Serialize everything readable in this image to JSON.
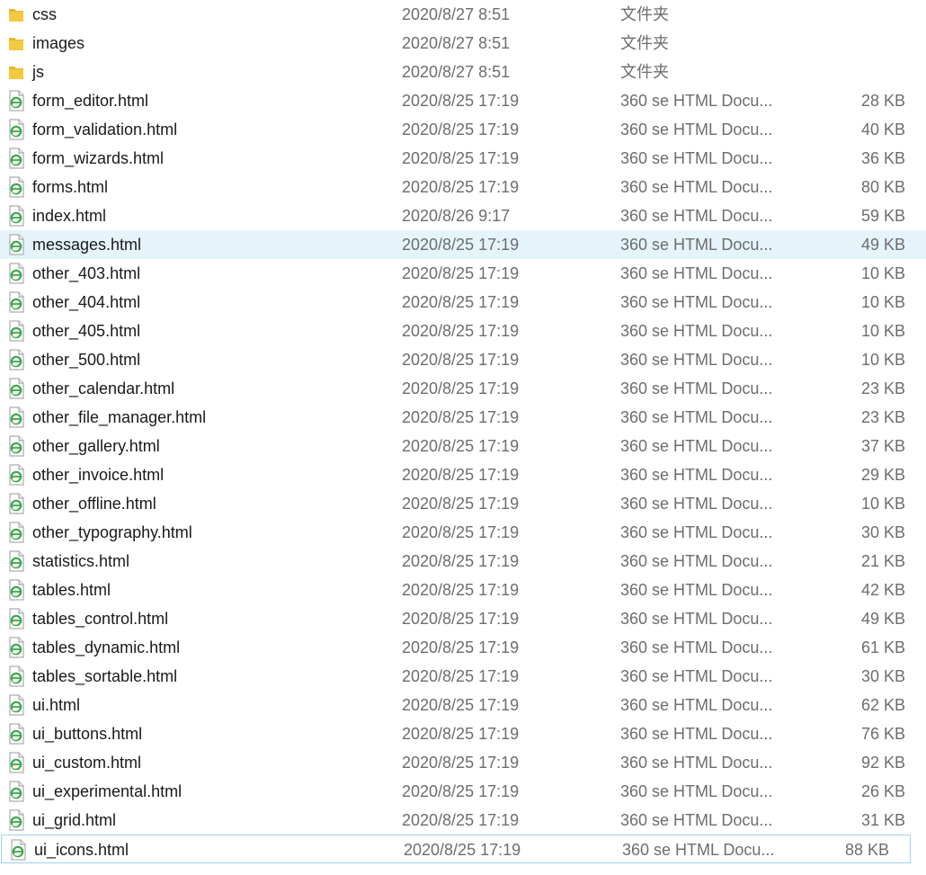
{
  "colors": {
    "selected_row_bg": "#e5f3fb",
    "focus_border": "#9fd0e8",
    "folder_yellow": "#f5c842",
    "html_icon_green": "#3aa64a"
  },
  "files": [
    {
      "name": "css",
      "date": "2020/8/27 8:51",
      "type": "文件夹",
      "size": "",
      "icon": "folder-icon"
    },
    {
      "name": "images",
      "date": "2020/8/27 8:51",
      "type": "文件夹",
      "size": "",
      "icon": "folder-icon"
    },
    {
      "name": "js",
      "date": "2020/8/27 8:51",
      "type": "文件夹",
      "size": "",
      "icon": "folder-icon"
    },
    {
      "name": "form_editor.html",
      "date": "2020/8/25 17:19",
      "type": "360 se HTML Docu...",
      "size": "28 KB",
      "icon": "html-file-icon"
    },
    {
      "name": "form_validation.html",
      "date": "2020/8/25 17:19",
      "type": "360 se HTML Docu...",
      "size": "40 KB",
      "icon": "html-file-icon"
    },
    {
      "name": "form_wizards.html",
      "date": "2020/8/25 17:19",
      "type": "360 se HTML Docu...",
      "size": "36 KB",
      "icon": "html-file-icon"
    },
    {
      "name": "forms.html",
      "date": "2020/8/25 17:19",
      "type": "360 se HTML Docu...",
      "size": "80 KB",
      "icon": "html-file-icon"
    },
    {
      "name": "index.html",
      "date": "2020/8/26 9:17",
      "type": "360 se HTML Docu...",
      "size": "59 KB",
      "icon": "html-file-icon"
    },
    {
      "name": "messages.html",
      "date": "2020/8/25 17:19",
      "type": "360 se HTML Docu...",
      "size": "49 KB",
      "icon": "html-file-icon",
      "state": "selected"
    },
    {
      "name": "other_403.html",
      "date": "2020/8/25 17:19",
      "type": "360 se HTML Docu...",
      "size": "10 KB",
      "icon": "html-file-icon"
    },
    {
      "name": "other_404.html",
      "date": "2020/8/25 17:19",
      "type": "360 se HTML Docu...",
      "size": "10 KB",
      "icon": "html-file-icon"
    },
    {
      "name": "other_405.html",
      "date": "2020/8/25 17:19",
      "type": "360 se HTML Docu...",
      "size": "10 KB",
      "icon": "html-file-icon"
    },
    {
      "name": "other_500.html",
      "date": "2020/8/25 17:19",
      "type": "360 se HTML Docu...",
      "size": "10 KB",
      "icon": "html-file-icon"
    },
    {
      "name": "other_calendar.html",
      "date": "2020/8/25 17:19",
      "type": "360 se HTML Docu...",
      "size": "23 KB",
      "icon": "html-file-icon"
    },
    {
      "name": "other_file_manager.html",
      "date": "2020/8/25 17:19",
      "type": "360 se HTML Docu...",
      "size": "23 KB",
      "icon": "html-file-icon"
    },
    {
      "name": "other_gallery.html",
      "date": "2020/8/25 17:19",
      "type": "360 se HTML Docu...",
      "size": "37 KB",
      "icon": "html-file-icon"
    },
    {
      "name": "other_invoice.html",
      "date": "2020/8/25 17:19",
      "type": "360 se HTML Docu...",
      "size": "29 KB",
      "icon": "html-file-icon"
    },
    {
      "name": "other_offline.html",
      "date": "2020/8/25 17:19",
      "type": "360 se HTML Docu...",
      "size": "10 KB",
      "icon": "html-file-icon"
    },
    {
      "name": "other_typography.html",
      "date": "2020/8/25 17:19",
      "type": "360 se HTML Docu...",
      "size": "30 KB",
      "icon": "html-file-icon"
    },
    {
      "name": "statistics.html",
      "date": "2020/8/25 17:19",
      "type": "360 se HTML Docu...",
      "size": "21 KB",
      "icon": "html-file-icon"
    },
    {
      "name": "tables.html",
      "date": "2020/8/25 17:19",
      "type": "360 se HTML Docu...",
      "size": "42 KB",
      "icon": "html-file-icon"
    },
    {
      "name": "tables_control.html",
      "date": "2020/8/25 17:19",
      "type": "360 se HTML Docu...",
      "size": "49 KB",
      "icon": "html-file-icon"
    },
    {
      "name": "tables_dynamic.html",
      "date": "2020/8/25 17:19",
      "type": "360 se HTML Docu...",
      "size": "61 KB",
      "icon": "html-file-icon"
    },
    {
      "name": "tables_sortable.html",
      "date": "2020/8/25 17:19",
      "type": "360 se HTML Docu...",
      "size": "30 KB",
      "icon": "html-file-icon"
    },
    {
      "name": "ui.html",
      "date": "2020/8/25 17:19",
      "type": "360 se HTML Docu...",
      "size": "62 KB",
      "icon": "html-file-icon"
    },
    {
      "name": "ui_buttons.html",
      "date": "2020/8/25 17:19",
      "type": "360 se HTML Docu...",
      "size": "76 KB",
      "icon": "html-file-icon"
    },
    {
      "name": "ui_custom.html",
      "date": "2020/8/25 17:19",
      "type": "360 se HTML Docu...",
      "size": "92 KB",
      "icon": "html-file-icon"
    },
    {
      "name": "ui_experimental.html",
      "date": "2020/8/25 17:19",
      "type": "360 se HTML Docu...",
      "size": "26 KB",
      "icon": "html-file-icon"
    },
    {
      "name": "ui_grid.html",
      "date": "2020/8/25 17:19",
      "type": "360 se HTML Docu...",
      "size": "31 KB",
      "icon": "html-file-icon"
    },
    {
      "name": "ui_icons.html",
      "date": "2020/8/25 17:19",
      "type": "360 se HTML Docu...",
      "size": "88 KB",
      "icon": "html-file-icon",
      "state": "focused"
    }
  ]
}
